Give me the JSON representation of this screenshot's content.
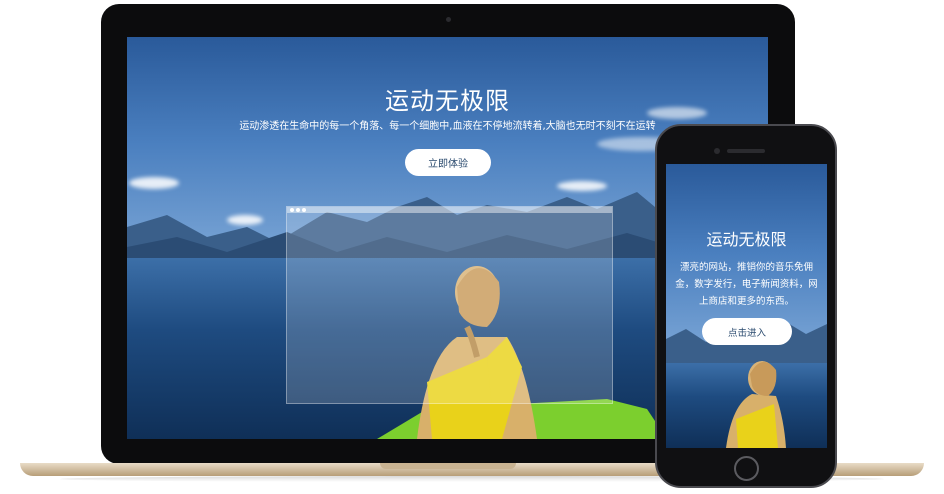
{
  "laptop": {
    "hero": {
      "title": "运动无极限",
      "subtitle": "运动渗透在生命中的每一个角落、每一个细胞中,血液在不停地流转着,大脑也无时不刻不在运转",
      "button_label": "立即体验"
    }
  },
  "phone": {
    "hero": {
      "title": "运动无极限",
      "text": "漂亮的网站，推销你的音乐免佣金，数字发行，电子新闻资料，网上商店和更多的东西。",
      "button_label": "点击进入"
    }
  },
  "colors": {
    "accent_text": "#2a4a6e",
    "sky": "#4a7fbf",
    "water": "#1e4b80",
    "kayak": "#7ccf2e",
    "device_frame": "#0c0c0d",
    "laptop_base": "#d8c6a8"
  },
  "icons": {
    "laptop_camera": "camera-icon",
    "phone_home": "home-button-icon",
    "phone_speaker": "speaker-icon"
  }
}
